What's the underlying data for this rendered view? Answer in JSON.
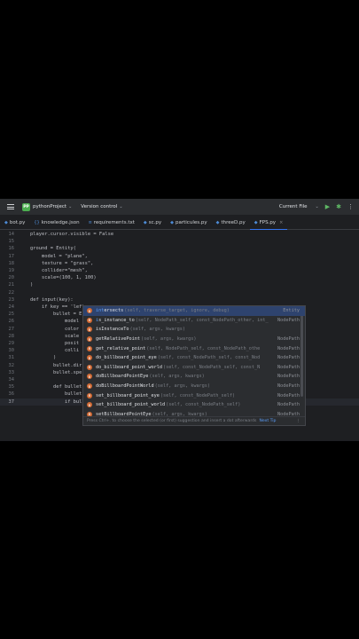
{
  "toolbar": {
    "project_badge": "PP",
    "project_name": "pythonProject",
    "version_control": "Version control",
    "run_config": "Current File"
  },
  "tabs": [
    {
      "label": "bot.py"
    },
    {
      "label": "knowledge.json"
    },
    {
      "label": "requirements.txt"
    },
    {
      "label": "sc.py"
    },
    {
      "label": "particules.py"
    },
    {
      "label": "threeD.py"
    },
    {
      "label": "FPS.py",
      "active": true
    }
  ],
  "code_lines": [
    {
      "n": "",
      "text": "player.cursor.visible = False",
      "top": 0
    },
    {
      "n": "14",
      "text": "player.cursor.visible = False"
    },
    {
      "n": "15",
      "text": ""
    },
    {
      "n": "16",
      "text": "ground = Entity("
    },
    {
      "n": "17",
      "text": "    model = \"plane\","
    },
    {
      "n": "18",
      "text": "    texture = \"grass\","
    },
    {
      "n": "19",
      "text": "    collider=\"mesh\","
    },
    {
      "n": "20",
      "text": "    scale=(100, 1, 100)"
    },
    {
      "n": "21",
      "text": ")"
    },
    {
      "n": "22",
      "text": ""
    },
    {
      "n": "23",
      "text": "def input(key):"
    },
    {
      "n": "24",
      "text": "    if key == 'left"
    },
    {
      "n": "25",
      "text": "        bullet = E"
    },
    {
      "n": "26",
      "text": "            model"
    },
    {
      "n": "27",
      "text": "            color"
    },
    {
      "n": "28",
      "text": "            scale"
    },
    {
      "n": "29",
      "text": "            posit"
    },
    {
      "n": "30",
      "text": "            colli"
    },
    {
      "n": "31",
      "text": "        )"
    },
    {
      "n": "32",
      "text": "        bullet.dir"
    },
    {
      "n": "33",
      "text": "        bullet.spe"
    },
    {
      "n": "34",
      "text": ""
    },
    {
      "n": "35",
      "text": "        def bullet"
    },
    {
      "n": "36",
      "text": "            bullet"
    },
    {
      "n": "37",
      "text": "            if bullet.int"
    }
  ],
  "completion": {
    "items": [
      {
        "match": "int",
        "before": "",
        "after": "ersects",
        "sig": "(self, traverse_target, ignore, debug)",
        "type": "Entity"
      },
      {
        "match": "i",
        "before": "",
        "after": "s_instance_to",
        "sig": "(self, NodePath_self, const_NodePath_other, int_",
        "type": "NodePath"
      },
      {
        "match": "",
        "before": "",
        "after": "isInstanceTo",
        "sig": "(self, args, kwargs)",
        "type": ""
      },
      {
        "match": "",
        "before": "",
        "after": "getRelativePoint",
        "sig": "(self, args, kwargs)",
        "type": "NodePath"
      },
      {
        "match": "",
        "before": "",
        "after": "get_relative_point",
        "sig": "(self, NodePath_self, const_NodePath_othe",
        "type": "NodePath"
      },
      {
        "match": "",
        "before": "",
        "after": "do_billboard_point_eye",
        "sig": "(self, const_NodePath_self, const_Nod",
        "type": "NodePath"
      },
      {
        "match": "",
        "before": "",
        "after": "do_billboard_point_world",
        "sig": "(self, const_NodePath_self, const_N",
        "type": "NodePath"
      },
      {
        "match": "",
        "before": "",
        "after": "doBillboardPointEye",
        "sig": "(self, args, kwargs)",
        "type": "NodePath"
      },
      {
        "match": "",
        "before": "",
        "after": "doBillboardPointWorld",
        "sig": "(self, args, kwargs)",
        "type": "NodePath"
      },
      {
        "match": "",
        "before": "",
        "after": "set_billboard_point_eye",
        "sig": "(self, const_NodePath_self)",
        "type": "NodePath"
      },
      {
        "match": "",
        "before": "",
        "after": "set_billboard_point_world",
        "sig": "(self, const_NodePath_self)",
        "type": "NodePath"
      },
      {
        "match": "",
        "before": "",
        "after": "setBillboardPointEye",
        "sig": "(self, args, kwargs)",
        "type": "NodePath"
      }
    ],
    "footer_hint": "Press Ctrl+. to choose the selected (or first) suggestion and insert a dot afterwards",
    "footer_link": "Next Tip"
  }
}
